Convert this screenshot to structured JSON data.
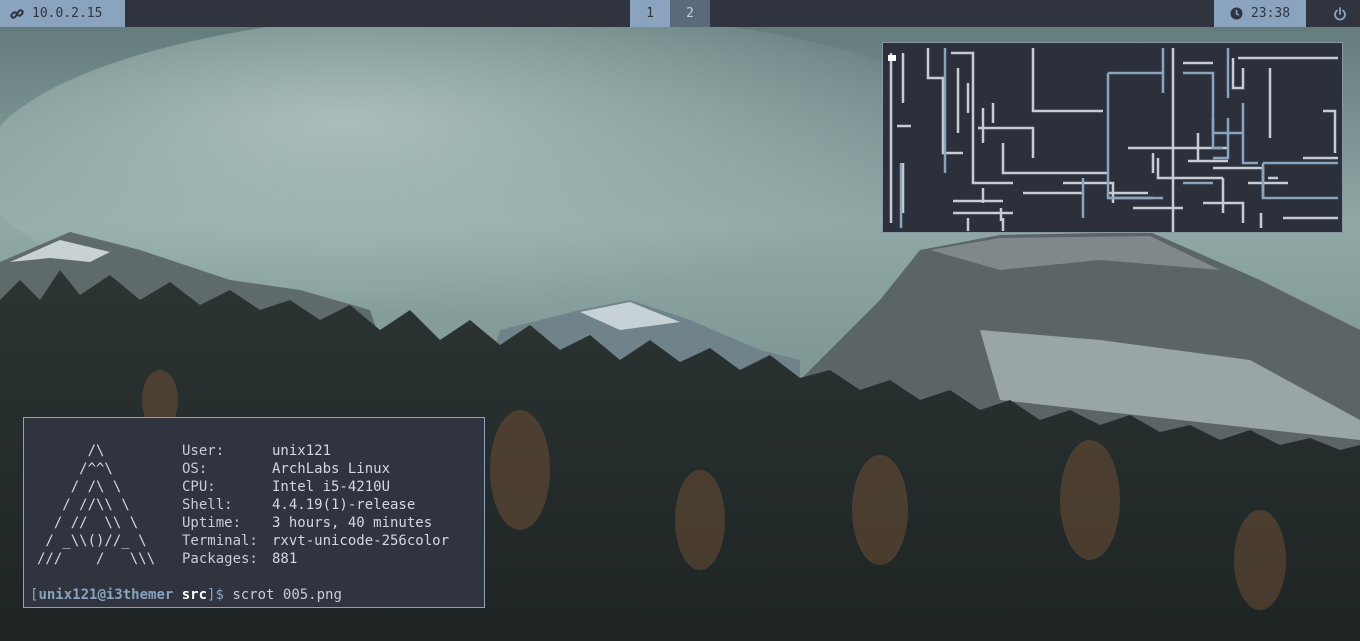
{
  "topbar": {
    "ip": {
      "icon": "link-icon",
      "text": "10.0.2.15"
    },
    "workspaces": [
      {
        "label": "1",
        "active": true
      },
      {
        "label": "2",
        "active": false
      }
    ],
    "clock": {
      "icon": "clock-icon",
      "time": "23:38"
    },
    "power": {
      "icon": "power-icon"
    },
    "colors": {
      "bar": "#2f343f",
      "accent": "#8aa4c0",
      "inactive": "#5b6a7a"
    }
  },
  "pipes_window": {
    "content": "pipes screensaver animation"
  },
  "terminal": {
    "ascii_logo": "      /\\\n     /^^\\\n    / /\\ \\\n   / //\\\\ \\\n  / //  \\\\ \\\n / _\\\\()//_ \\\n///    /   \\\\\\",
    "info": [
      {
        "key": "User:",
        "value": "unix121"
      },
      {
        "key": "OS:",
        "value": "ArchLabs Linux"
      },
      {
        "key": "CPU:",
        "value": "Intel i5-4210U"
      },
      {
        "key": "Shell:",
        "value": "4.4.19(1)-release"
      },
      {
        "key": "Uptime:",
        "value": "3 hours, 40 minutes"
      },
      {
        "key": "Terminal:",
        "value": "rxvt-unicode-256color"
      },
      {
        "key": "Packages:",
        "value": "881"
      }
    ],
    "prompt": {
      "open": "[",
      "user_host": "unix121@i3themer",
      "dir": "src",
      "close": "]$ ",
      "command": "scrot 005.png"
    }
  }
}
